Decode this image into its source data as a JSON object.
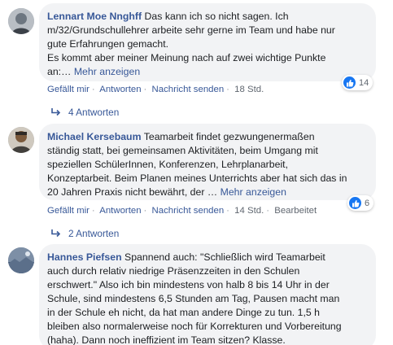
{
  "comments": [
    {
      "author": "Lennart Moe Nnghff",
      "text_lines": [
        "Das kann ich so nicht sagen. Ich",
        "m/32/Grundschullehrer arbeite sehr gerne im Team und habe nur",
        "gute Erfahrungen gemacht.",
        "Es kommt aber meiner Meinung nach auf zwei wichtige Punkte",
        "an:… "
      ],
      "more_label": "Mehr anzeigen",
      "reaction_icon": "like-icon",
      "reaction_count": "14",
      "actions": {
        "like": "Gefällt mir",
        "reply": "Antworten",
        "message": "Nachricht senden",
        "time": "18 Std."
      },
      "replies_label": "4 Antworten"
    },
    {
      "author": "Michael Kersebaum",
      "text_lines": [
        "Teamarbeit findet gezwungenermaßen",
        "ständig statt, bei gemeinsamen Aktivitäten, beim Umgang mit",
        "speziellen SchülerInnen, Konferenzen, Lehrplanarbeit,",
        "Konzeptarbeit. Beim Planen meines Unterrichts aber hat sich das in",
        "20 Jahren Praxis nicht bewährt, der … "
      ],
      "more_label": "Mehr anzeigen",
      "reaction_icon": "like-icon",
      "reaction_count": "6",
      "actions": {
        "like": "Gefällt mir",
        "reply": "Antworten",
        "message": "Nachricht senden",
        "time": "14 Std.",
        "edited": "Bearbeitet"
      },
      "replies_label": "2 Antworten"
    },
    {
      "author": "Hannes Piefsen",
      "text_lines": [
        "Spannend auch: \"Schließlich wird Teamarbeit",
        "auch durch relativ niedrige Präsenzzeiten in den Schulen",
        "erschwert.\" Also ich bin mindestens von halb 8 bis 14 Uhr in der",
        "Schule, sind mindestens 6,5 Stunden am Tag, Pausen macht man",
        "in der Schule eh nicht, da hat man andere Dinge zu tun. 1,5 h",
        "bleiben also normalerweise noch für Korrekturen und Vorbereitung",
        "(haha). Dann noch ineffizient im Team sitzen? Klasse."
      ]
    }
  ],
  "colors": {
    "link": "#385898",
    "bubble": "#f2f3f5",
    "meta": "#606770",
    "like": "#1877f2"
  }
}
